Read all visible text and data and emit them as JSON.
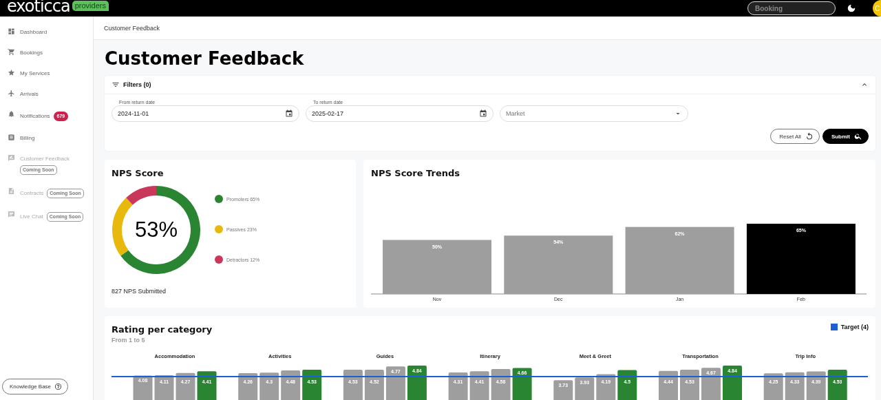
{
  "topbar": {
    "logo": "exoticca",
    "logo_badge": "providers",
    "search": {
      "placeholder": "Booking"
    },
    "avatar": "C"
  },
  "sidebar": {
    "items": [
      {
        "label": "Dashboard",
        "disabled": false
      },
      {
        "label": "Bookings",
        "disabled": false
      },
      {
        "label": "My Services",
        "disabled": false
      },
      {
        "label": "Arrivals",
        "disabled": false
      },
      {
        "label": "Notifications",
        "disabled": false,
        "badge": {
          "kind": "count",
          "text": "679"
        }
      },
      {
        "label": "Billing",
        "disabled": false
      },
      {
        "label": "Customer Feedback",
        "disabled": true,
        "badge": {
          "kind": "soon",
          "text": "Coming Soon"
        }
      },
      {
        "label": "Contracts",
        "disabled": true,
        "badge": {
          "kind": "soon",
          "text": "Coming Soon"
        }
      },
      {
        "label": "Live Chat",
        "disabled": true,
        "badge": {
          "kind": "soon",
          "text": "Coming Soon"
        }
      }
    ],
    "footer_button": "Knowledge Base"
  },
  "breadcrumb": "Customer Feedback",
  "page_title": "Customer Feedback",
  "filters": {
    "title": "Filters (0)",
    "expanded": true,
    "fields": [
      {
        "kind": "date",
        "label": "From return date",
        "value": "2024-11-01"
      },
      {
        "kind": "date",
        "label": "To return date",
        "value": "2025-02-17"
      },
      {
        "kind": "select",
        "placeholder": "Market"
      }
    ],
    "buttons": [
      {
        "kind": "outline",
        "label": "Reset All"
      },
      {
        "kind": "primary",
        "label": "Submit"
      }
    ]
  },
  "nps_score": {
    "title": "NPS Score",
    "center": "53%",
    "legend": [
      {
        "color": "#2a8532"
      },
      {
        "color": "#e8b90c"
      },
      {
        "color": "#c9385a"
      }
    ],
    "chart_data": {
      "type": "donut",
      "categories": [
        "Promoters 65%",
        "Passives 23%",
        "Detractors 12%"
      ],
      "values": [
        65,
        23,
        12
      ]
    },
    "submitted": "827 NPS Submitted"
  },
  "nps_trends": {
    "title": "NPS Score Trends",
    "chart_data": {
      "type": "bar",
      "categories": [
        "Nov",
        "Dec",
        "Jan",
        "Feb"
      ],
      "series": [
        {
          "color": "#9e9e9e",
          "values": [
            50,
            54,
            62,
            null
          ],
          "value_labels": [
            "50%",
            "54%",
            "62%",
            null
          ]
        },
        {
          "color": "#000000",
          "values": [
            null,
            null,
            null,
            65
          ],
          "value_labels": [
            null,
            null,
            null,
            "65%"
          ]
        }
      ]
    }
  },
  "rating": {
    "title": "Rating per category",
    "subtitle": "From 1 to 5",
    "legend": [
      {
        "label": "Target (4)",
        "color": "#1a5fd6"
      }
    ],
    "chart_data": {
      "type": "bar",
      "categories": [
        "Accommodation",
        "Activities",
        "Guides",
        "Itinerary",
        "Meet & Greet",
        "Transportation",
        "Trip Info"
      ],
      "data_labels": true,
      "series": [
        {
          "color": "#9e9e9e",
          "values": [
            4.08,
            4.26,
            4.53,
            4.31,
            3.73,
            4.44,
            4.25
          ]
        },
        {
          "color": "#9e9e9e",
          "values": [
            4.11,
            4.3,
            4.52,
            4.41,
            3.93,
            4.53,
            4.33
          ]
        },
        {
          "color": "#9e9e9e",
          "values": [
            4.27,
            4.48,
            4.77,
            4.58,
            4.19,
            4.67,
            4.39
          ]
        },
        {
          "color": "#2a8532",
          "values": [
            4.41,
            4.53,
            4.84,
            4.66,
            4.5,
            4.84,
            4.53
          ]
        }
      ]
    }
  }
}
